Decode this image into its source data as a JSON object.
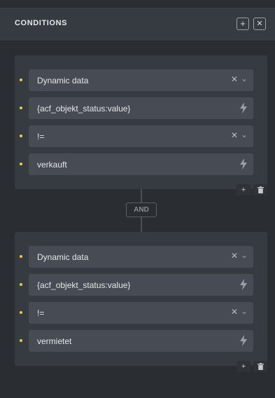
{
  "panel": {
    "title": "CONDITIONS",
    "add_icon": "plus-icon",
    "close_icon": "close-icon"
  },
  "colors": {
    "bullet": "#f2c94c",
    "field_bg": "#474c54",
    "group_bg": "#363a41"
  },
  "groups": [
    {
      "rows": [
        {
          "value": "Dynamic data",
          "kind": "select"
        },
        {
          "value": "{acf_objekt_status:value}",
          "kind": "dynamic"
        },
        {
          "value": "!=",
          "kind": "select"
        },
        {
          "value": "verkauft",
          "kind": "dynamic"
        }
      ]
    },
    {
      "rows": [
        {
          "value": "Dynamic data",
          "kind": "select"
        },
        {
          "value": "{acf_objekt_status:value}",
          "kind": "dynamic"
        },
        {
          "value": "!=",
          "kind": "select"
        },
        {
          "value": "vermietet",
          "kind": "dynamic"
        }
      ]
    }
  ],
  "connector": {
    "label": "AND"
  }
}
